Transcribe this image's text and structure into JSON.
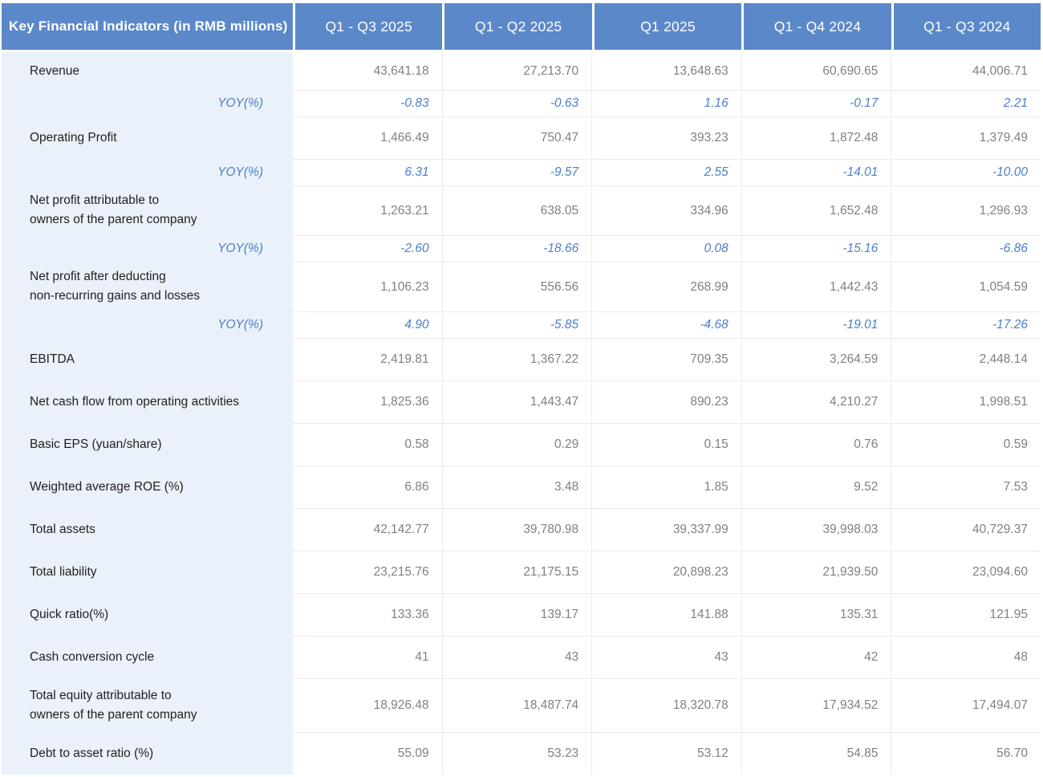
{
  "chart_data": {
    "type": "table",
    "title": "Key Financial Indicators (in RMB millions)",
    "columns": [
      "Q1 - Q3 2025",
      "Q1 - Q2 2025",
      "Q1 2025",
      "Q1 - Q4 2024",
      "Q1 - Q3 2024"
    ],
    "rows": [
      {
        "kind": "metric",
        "label": "Revenue",
        "values": [
          "43,641.18",
          "27,213.70",
          "13,648.63",
          "60,690.65",
          "44,006.71"
        ]
      },
      {
        "kind": "yoy",
        "label": "YOY(%)",
        "values": [
          "-0.83",
          "-0.63",
          "1.16",
          "-0.17",
          "2.21"
        ]
      },
      {
        "kind": "metric",
        "label": "Operating Profit",
        "values": [
          "1,466.49",
          "750.47",
          "393.23",
          "1,872.48",
          "1,379.49"
        ]
      },
      {
        "kind": "yoy",
        "label": "YOY(%)",
        "values": [
          "6.31",
          "-9.57",
          "2.55",
          "-14.01",
          "-10.00"
        ]
      },
      {
        "kind": "metric",
        "label": "Net profit attributable to\nowners of the parent company",
        "values": [
          "1,263.21",
          "638.05",
          "334.96",
          "1,652.48",
          "1,296.93"
        ]
      },
      {
        "kind": "yoy",
        "label": "YOY(%)",
        "values": [
          "-2.60",
          "-18.66",
          "0.08",
          "-15.16",
          "-6.86"
        ]
      },
      {
        "kind": "metric",
        "label": "Net profit after deducting\nnon-recurring gains and losses",
        "values": [
          "1,106.23",
          "556.56",
          "268.99",
          "1,442.43",
          "1,054.59"
        ]
      },
      {
        "kind": "yoy",
        "label": "YOY(%)",
        "values": [
          "4.90",
          "-5.85",
          "-4.68",
          "-19.01",
          "-17.26"
        ]
      },
      {
        "kind": "metric",
        "label": "EBITDA",
        "values": [
          "2,419.81",
          "1,367.22",
          "709.35",
          "3,264.59",
          "2,448.14"
        ]
      },
      {
        "kind": "metric",
        "label": "Net cash flow from operating activities",
        "values": [
          "1,825.36",
          "1,443.47",
          "890.23",
          "4,210.27",
          "1,998.51"
        ]
      },
      {
        "kind": "metric",
        "label": "Basic EPS (yuan/share)",
        "values": [
          "0.58",
          "0.29",
          "0.15",
          "0.76",
          "0.59"
        ]
      },
      {
        "kind": "metric",
        "label": "Weighted average ROE (%)",
        "values": [
          "6.86",
          "3.48",
          "1.85",
          "9.52",
          "7.53"
        ]
      },
      {
        "kind": "metric",
        "label": "Total assets",
        "values": [
          "42,142.77",
          "39,780.98",
          "39,337.99",
          "39,998.03",
          "40,729.37"
        ]
      },
      {
        "kind": "metric",
        "label": "Total liability",
        "values": [
          "23,215.76",
          "21,175.15",
          "20,898.23",
          "21,939.50",
          "23,094.60"
        ]
      },
      {
        "kind": "metric",
        "label": "Quick ratio(%)",
        "values": [
          "133.36",
          "139.17",
          "141.88",
          "135.31",
          "121.95"
        ]
      },
      {
        "kind": "metric",
        "label": "Cash conversion cycle",
        "values": [
          "41",
          "43",
          "43",
          "42",
          "48"
        ]
      },
      {
        "kind": "metric",
        "label": "Total equity attributable to\nowners of the parent company",
        "values": [
          "18,926.48",
          "18,487.74",
          "18,320.78",
          "17,934.52",
          "17,494.07"
        ]
      },
      {
        "kind": "metric",
        "label": "Debt to asset ratio (%)",
        "values": [
          "55.09",
          "53.23",
          "53.12",
          "54.85",
          "56.70"
        ]
      }
    ],
    "colors": {
      "header_bg": "#5b88c9",
      "header_text": "#ffffff",
      "label_column_bg": "#eaf1fa",
      "label_text": "#1f1f1f",
      "value_text": "#808080",
      "yoy_text": "#4d7fca",
      "grid_line": "#ebebeb"
    }
  }
}
